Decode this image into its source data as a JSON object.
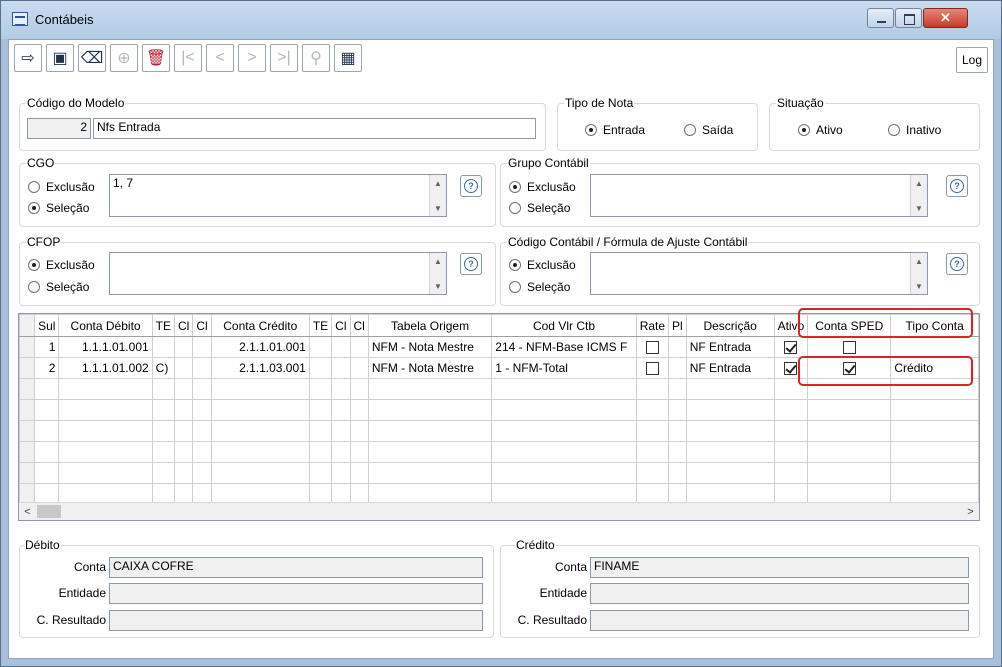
{
  "window": {
    "title": "Contábeis"
  },
  "toolbar": {
    "buttons": [
      {
        "name": "exit-icon",
        "glyph": "⇨",
        "state": "enabled"
      },
      {
        "name": "save-icon",
        "glyph": "▣",
        "state": "enabled"
      },
      {
        "name": "eraser-icon",
        "glyph": "⌫",
        "state": "enabled"
      },
      {
        "name": "add-icon",
        "glyph": "⊕",
        "state": "disabled"
      },
      {
        "name": "delete-icon",
        "glyph": "🗑",
        "state": "red"
      },
      {
        "name": "first-icon",
        "glyph": "|<",
        "state": "disabled"
      },
      {
        "name": "prev-icon",
        "glyph": "<",
        "state": "disabled"
      },
      {
        "name": "next-icon",
        "glyph": ">",
        "state": "disabled"
      },
      {
        "name": "last-icon",
        "glyph": ">|",
        "state": "disabled"
      },
      {
        "name": "search-icon",
        "glyph": "⚲",
        "state": "disabled"
      },
      {
        "name": "grid-icon",
        "glyph": "▦",
        "state": "enabled"
      }
    ],
    "log_label": "Log"
  },
  "modelo": {
    "label": "Código do Modelo",
    "codigo": "2",
    "nome": "Nfs Entrada"
  },
  "tipo_nota": {
    "label": "Tipo de Nota",
    "options": [
      "Entrada",
      "Saída"
    ],
    "selected": "Entrada"
  },
  "situacao": {
    "label": "Situação",
    "options": [
      "Ativo",
      "Inativo"
    ],
    "selected": "Ativo"
  },
  "cgo": {
    "label": "CGO",
    "options": [
      "Exclusão",
      "Seleção"
    ],
    "selected": "Seleção",
    "value": "1, 7"
  },
  "grupo_contabil": {
    "label": "Grupo Contábil",
    "options": [
      "Exclusão",
      "Seleção"
    ],
    "selected": "Exclusão",
    "value": ""
  },
  "cfop": {
    "label": "CFOP",
    "options": [
      "Exclusão",
      "Seleção"
    ],
    "selected": "Exclusão",
    "value": ""
  },
  "codigo_contabil": {
    "label": "Código Contábil / Fórmula de Ajuste Contábil",
    "options": [
      "Exclusão",
      "Seleção"
    ],
    "selected": "Exclusão",
    "value": ""
  },
  "grid": {
    "columns": [
      "Sul",
      "Conta Débito",
      "TE",
      "Cl",
      "Cl",
      "Conta Crédito",
      "TE",
      "Cl",
      "Cl",
      "Tabela Origem",
      "Cod Vlr Ctb",
      "Rate",
      "Pl",
      "Descrição",
      "Ativo",
      "Conta SPED",
      "Tipo Conta"
    ],
    "rows": [
      {
        "seq": "1",
        "conta_debito": "1.1.1.01.001",
        "te1": "",
        "conta_credito": "2.1.1.01.001",
        "tabela_origem": "NFM - Nota Mestre",
        "cod_vlr_ctb": "214 - NFM-Base ICMS F",
        "rateio": false,
        "descricao": "NF Entrada",
        "ativo": true,
        "conta_sped": false,
        "tipo_conta": ""
      },
      {
        "seq": "2",
        "conta_debito": "1.1.1.01.002",
        "te1": "C)",
        "conta_credito": "2.1.1.03.001",
        "tabela_origem": "NFM - Nota Mestre",
        "cod_vlr_ctb": "1 - NFM-Total",
        "rateio": false,
        "descricao": "NF Entrada",
        "ativo": true,
        "conta_sped": true,
        "tipo_conta": "Crédito"
      }
    ]
  },
  "debito": {
    "label": "Débito",
    "conta_label": "Conta",
    "conta": "CAIXA COFRE",
    "entidade_label": "Entidade",
    "entidade": "",
    "resultado_label": "C. Resultado",
    "resultado": ""
  },
  "credito": {
    "label": "Crédito",
    "conta_label": "Conta",
    "conta": "FINAME",
    "entidade_label": "Entidade",
    "entidade": "",
    "resultado_label": "C. Resultado",
    "resultado": ""
  },
  "colors": {
    "highlight": "#e0202a",
    "titlebar": "#b9cfe7",
    "close_button": "#c63b29"
  }
}
